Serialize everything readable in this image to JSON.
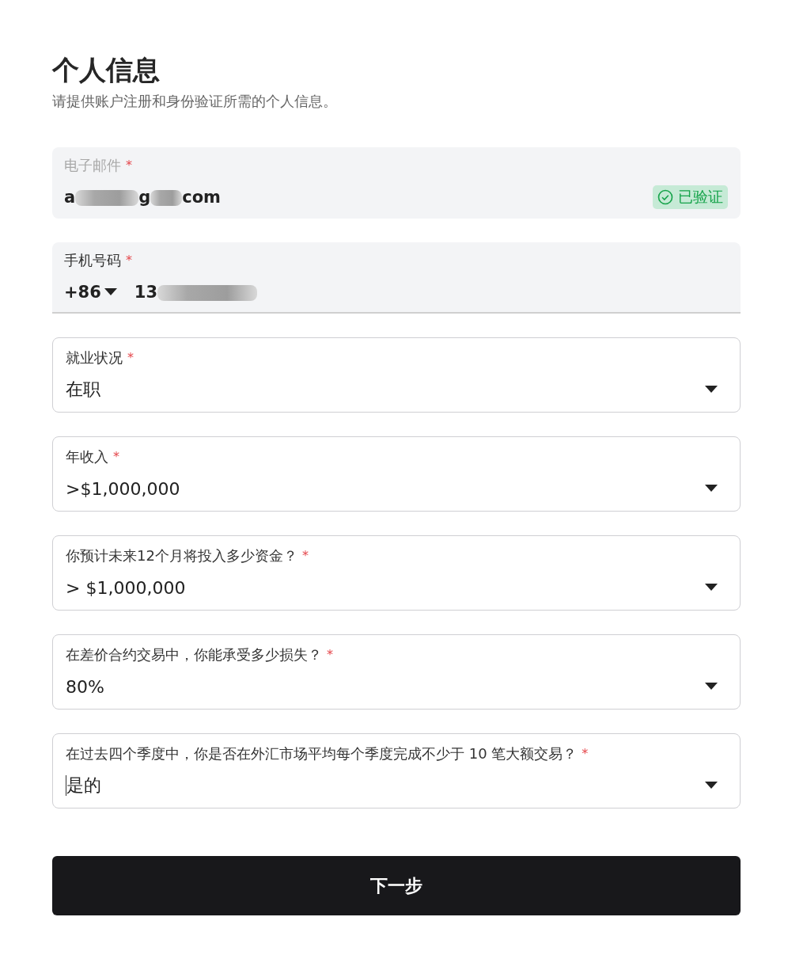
{
  "title": "个人信息",
  "subtitle": "请提供账户注册和身份验证所需的个人信息。",
  "fields": [
    {
      "kind": "email",
      "label": "电子邮件",
      "required_mark": "*",
      "disabled": true,
      "value_parts": [
        "a",
        "g",
        "com"
      ],
      "badge": {
        "text": "已验证",
        "verified": true
      },
      "focused": false
    },
    {
      "kind": "phone",
      "label": "手机号码",
      "required_mark": "*",
      "disabled": false,
      "country_code": "+86",
      "value_parts": [
        "13"
      ],
      "focused": false
    },
    {
      "kind": "select",
      "label": "就业状况",
      "required_mark": "*",
      "disabled": false,
      "value": "在职",
      "focused": false
    },
    {
      "kind": "select",
      "label": "年收入",
      "required_mark": "*",
      "disabled": false,
      "value": ">$1,000,000",
      "focused": false
    },
    {
      "kind": "select",
      "label": "你预计未来12个月将投入多少资金？",
      "required_mark": "*",
      "disabled": false,
      "value": "> $1,000,000",
      "focused": false
    },
    {
      "kind": "select",
      "label": "在差价合约交易中，你能承受多少损失？",
      "required_mark": "*",
      "disabled": false,
      "value": "80%",
      "focused": false
    },
    {
      "kind": "select",
      "label": "在过去四个季度中，你是否在外汇市场平均每个季度完成不少于 10 笔大额交易？",
      "required_mark": "*",
      "disabled": false,
      "value": "是的",
      "focused": true
    }
  ],
  "next_button": "下一步"
}
